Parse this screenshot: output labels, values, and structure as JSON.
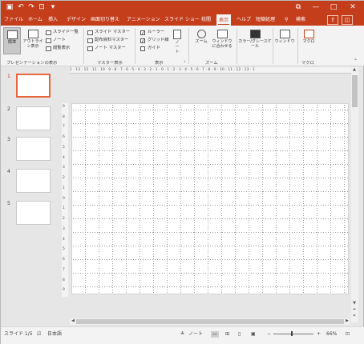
{
  "titlebar": {
    "qat": [
      "save-icon",
      "undo-icon",
      "redo-icon",
      "present-icon",
      "customize-icon"
    ],
    "window_controls": {
      "restore": "restore-icon",
      "minimize": "minimize-icon",
      "maximize": "maximize-icon",
      "close": "close-icon"
    },
    "colors": {
      "accent": "#c43e1c"
    }
  },
  "tabs": [
    {
      "label": "ファイル"
    },
    {
      "label": "ホーム"
    },
    {
      "label": "挿入"
    },
    {
      "label": "デザイン"
    },
    {
      "label": "画面切り替え"
    },
    {
      "label": "アニメーション"
    },
    {
      "label": "スライド ショー"
    },
    {
      "label": "校閲"
    },
    {
      "label": "表示",
      "active": true
    },
    {
      "label": "ヘルプ"
    },
    {
      "label": "短縮処理"
    }
  ],
  "search": {
    "label": "検索",
    "icon": "search-icon"
  },
  "ribbon": {
    "views": {
      "normal": "標準",
      "outline": "アウトライン表示",
      "slide_list": "スライド一覧",
      "notes": "ノート",
      "reading": "閲覧表示"
    },
    "views_group": "プレゼンテーションの表示",
    "masters": {
      "slide_master": "スライド マスター",
      "handout_master": "配布資料マスター",
      "notes_master": "ノート マスター"
    },
    "masters_group": "マスター表示",
    "show": {
      "ruler": "ルーラー",
      "gridlines": "グリッド線",
      "guides": "ガイド",
      "ruler_checked": true,
      "gridlines_checked": true,
      "guides_checked": false
    },
    "notes_button": "ノート",
    "show_group": "表示",
    "zoom": {
      "zoom": "ズーム",
      "fit": "ウィンドウに合わせる"
    },
    "zoom_group": "ズーム",
    "color": {
      "label": "カラー/グレースケール"
    },
    "window": {
      "label": "ウィンドウ"
    },
    "macro": {
      "label": "マクロ"
    },
    "macro_group": "マクロ"
  },
  "ruler_h": "1 · 13 · 12 · 11 · 10 · 9 · 8 · 7 · 6 · 5 · 4 · 3 · 2 · 1 · 0 · 1 · 2 · 3 · 4 · 5 · 6 · 7 · 8 · 9 · 10 · 11 · 12 · 13 · 1",
  "ruler_v": [
    "9",
    "8",
    "7",
    "6",
    "5",
    "4",
    "3",
    "2",
    "1",
    "0",
    "1",
    "2",
    "3",
    "4",
    "5",
    "6",
    "7",
    "8",
    "9"
  ],
  "slides": [
    {
      "number": "1",
      "active": true
    },
    {
      "number": "2"
    },
    {
      "number": "3"
    },
    {
      "number": "4"
    },
    {
      "number": "5"
    }
  ],
  "status": {
    "slide": "スライド 1/5",
    "language": "日本語",
    "notes": "ノート",
    "zoom": "66%"
  }
}
